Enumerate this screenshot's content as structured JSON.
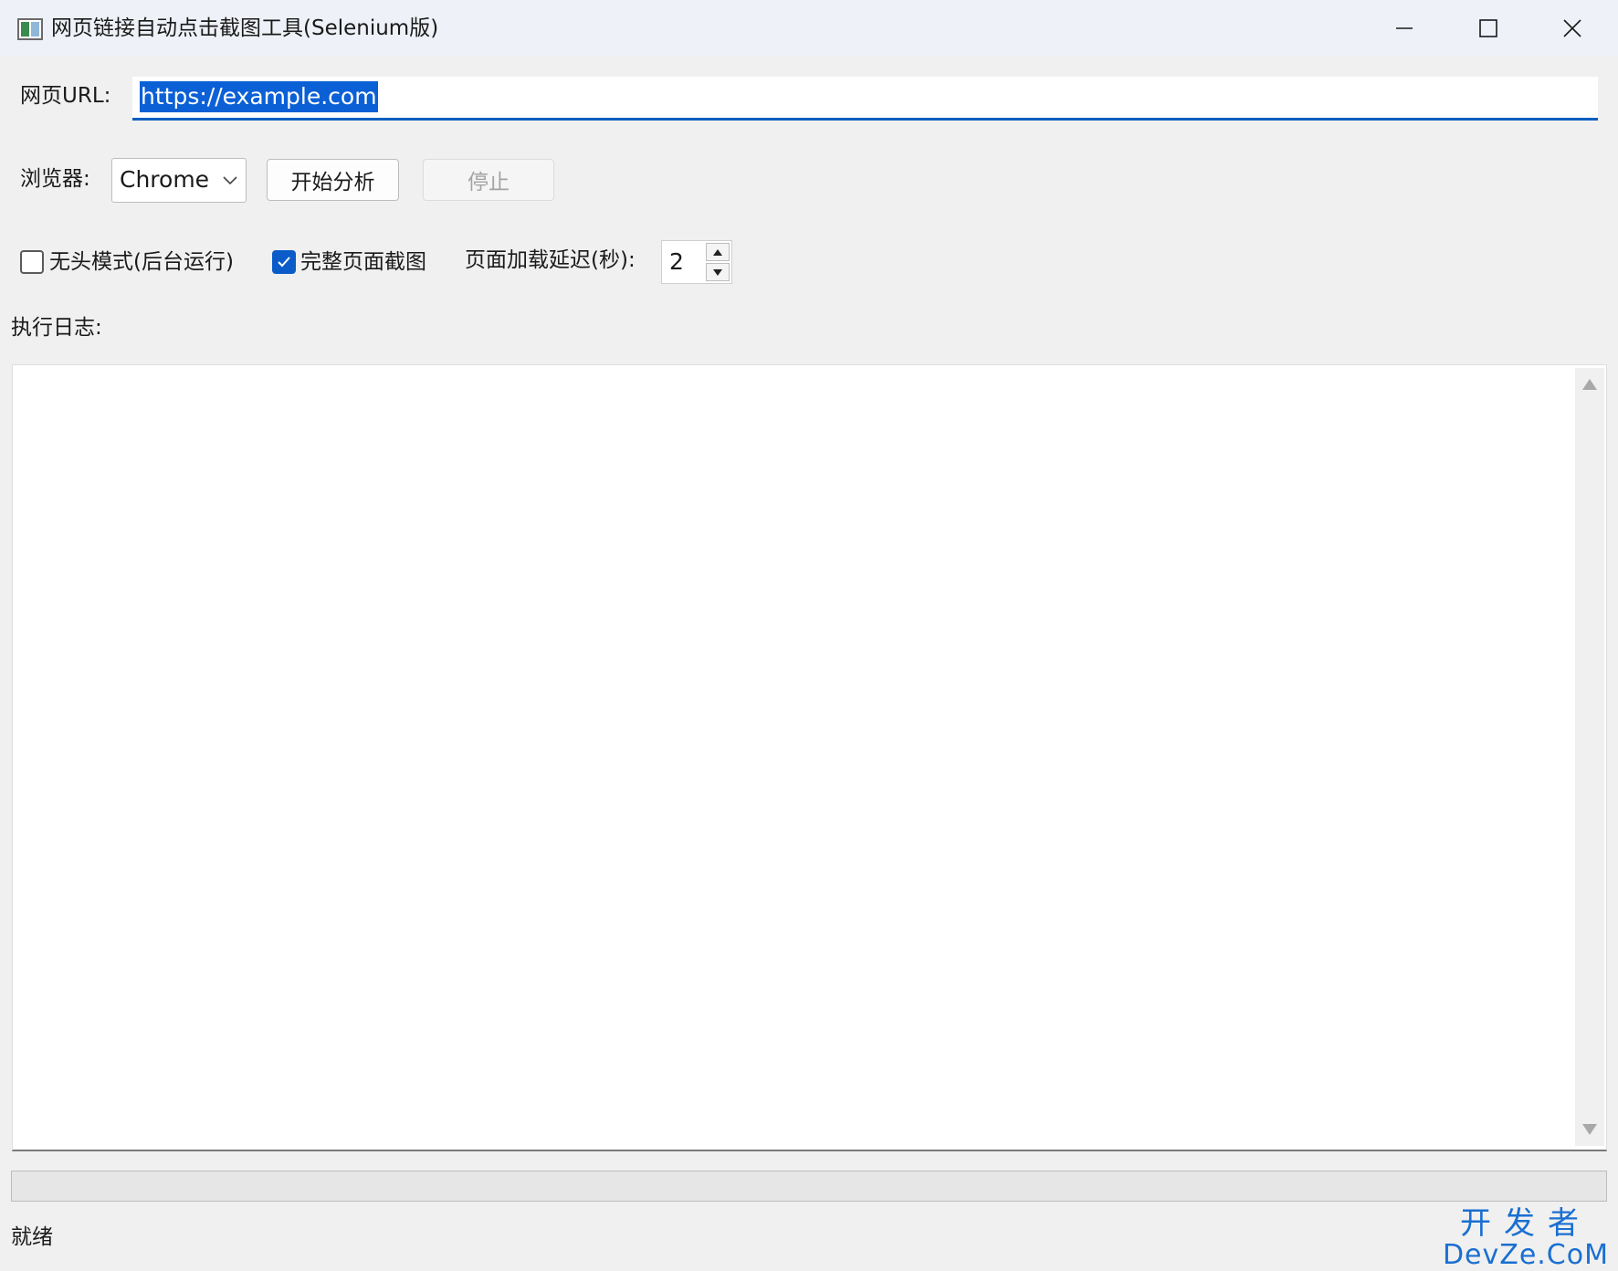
{
  "window": {
    "title": "网页链接自动点击截图工具(Selenium版)"
  },
  "url_row": {
    "label": "网页URL:",
    "value": "https://example.com"
  },
  "browser_row": {
    "label": "浏览器:",
    "selected": "Chrome",
    "start_button": "开始分析",
    "stop_button": "停止"
  },
  "options_row": {
    "headless_label": "无头模式(后台运行)",
    "headless_checked": false,
    "fullpage_label": "完整页面截图",
    "fullpage_checked": true,
    "delay_label": "页面加载延迟(秒):",
    "delay_value": "2"
  },
  "log": {
    "label": "执行日志:",
    "content": ""
  },
  "progress": {
    "value": 0
  },
  "status": {
    "text": "就绪"
  },
  "watermark": {
    "line1": "开发者",
    "line2": "DevZe.CoM"
  },
  "colors": {
    "accent": "#0b5cc9",
    "selection": "#0b60d6",
    "watermark": "#1a6fd1"
  }
}
